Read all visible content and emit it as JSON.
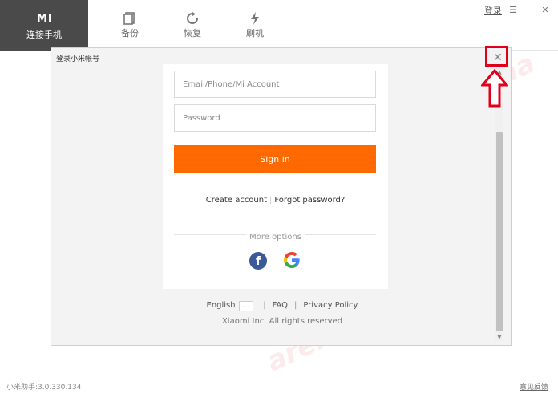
{
  "nav": {
    "active_label": "连接手机",
    "mi_logo": "MI",
    "items": [
      {
        "label": "备份",
        "icon": "backup-icon"
      },
      {
        "label": "恢复",
        "icon": "restore-icon"
      },
      {
        "label": "刷机",
        "icon": "flash-icon"
      }
    ]
  },
  "toplinks": {
    "login": "登录"
  },
  "dialog": {
    "title": "登录小米帐号",
    "account_placeholder": "Email/Phone/Mi Account",
    "password_placeholder": "Password",
    "signin_label": "Sign in",
    "create_account": "Create account",
    "forgot_password": "Forgot password?",
    "more_options": "More options",
    "facebook_icon": "facebook-icon",
    "google_icon": "google-icon",
    "language": "English",
    "language_button": "...",
    "faq": "FAQ",
    "privacy": "Privacy Policy",
    "copyright": "Xiaomi Inc. All rights reserved"
  },
  "statusbar": {
    "version": "小米助手:3.0.330.134",
    "feedback": "意见反馈"
  },
  "watermark": "arena",
  "colors": {
    "accent": "#ff6900",
    "highlight": "#e1001a",
    "nav_active": "#4a4a4a"
  }
}
